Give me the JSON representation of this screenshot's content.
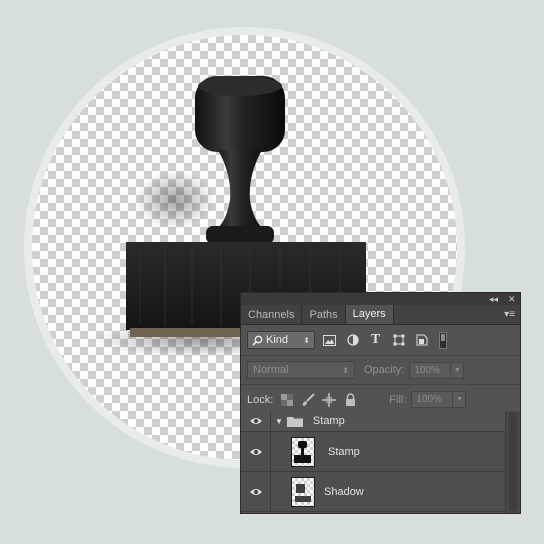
{
  "panel": {
    "tabs": [
      {
        "label": "Channels",
        "active": false
      },
      {
        "label": "Paths",
        "active": false
      },
      {
        "label": "Layers",
        "active": true
      }
    ],
    "filter": {
      "kind_label": "Kind",
      "icons": [
        "image-filter-icon",
        "adjustment-filter-icon",
        "type-filter-icon",
        "shape-filter-icon",
        "smart-object-filter-icon"
      ]
    },
    "blend_mode": "Normal",
    "opacity_label": "Opacity:",
    "opacity_value": "100%",
    "lock_label": "Lock:",
    "fill_label": "Fill:",
    "fill_value": "100%",
    "layers": [
      {
        "name": "Stamp",
        "type": "group",
        "visible": true,
        "expanded": true
      },
      {
        "name": "Stamp",
        "type": "layer",
        "visible": true
      },
      {
        "name": "Shadow",
        "type": "layer",
        "visible": true
      }
    ]
  },
  "colors": {
    "background": "#d7dfdc",
    "panel": "#535353",
    "stamp": "#1c1c1c"
  }
}
